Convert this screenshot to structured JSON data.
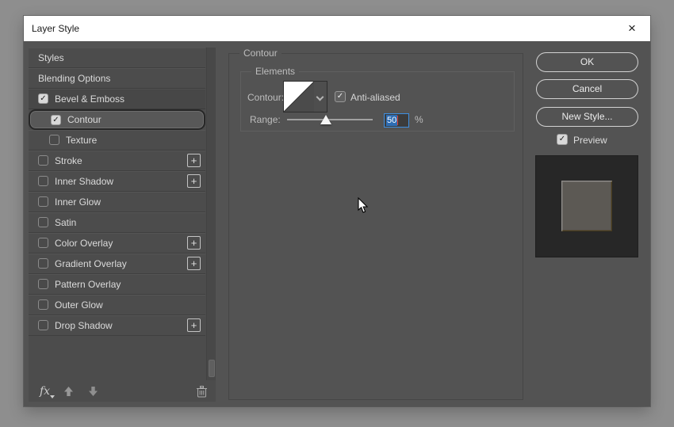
{
  "window": {
    "title": "Layer Style"
  },
  "icons": {
    "close": "×",
    "check": "✓",
    "plus": "+"
  },
  "sidebar": {
    "items": [
      {
        "label": "Styles",
        "checkbox": null,
        "sub": false,
        "selected": false,
        "plus": false,
        "emph": false
      },
      {
        "label": "Blending Options",
        "checkbox": null,
        "sub": false,
        "selected": false,
        "plus": false,
        "emph": false
      },
      {
        "label": "Bevel & Emboss",
        "checkbox": "checked",
        "sub": false,
        "selected": false,
        "plus": false,
        "emph": true
      },
      {
        "label": "Contour",
        "checkbox": "checked",
        "sub": true,
        "selected": true,
        "plus": false,
        "emph": false
      },
      {
        "label": "Texture",
        "checkbox": "unchecked",
        "sub": true,
        "selected": false,
        "plus": false,
        "emph": false
      },
      {
        "label": "Stroke",
        "checkbox": "unchecked",
        "sub": false,
        "selected": false,
        "plus": true,
        "emph": false
      },
      {
        "label": "Inner Shadow",
        "checkbox": "unchecked",
        "sub": false,
        "selected": false,
        "plus": true,
        "emph": false
      },
      {
        "label": "Inner Glow",
        "checkbox": "unchecked",
        "sub": false,
        "selected": false,
        "plus": false,
        "emph": false
      },
      {
        "label": "Satin",
        "checkbox": "unchecked",
        "sub": false,
        "selected": false,
        "plus": false,
        "emph": false
      },
      {
        "label": "Color Overlay",
        "checkbox": "unchecked",
        "sub": false,
        "selected": false,
        "plus": true,
        "emph": false
      },
      {
        "label": "Gradient Overlay",
        "checkbox": "unchecked",
        "sub": false,
        "selected": false,
        "plus": true,
        "emph": false
      },
      {
        "label": "Pattern Overlay",
        "checkbox": "unchecked",
        "sub": false,
        "selected": false,
        "plus": false,
        "emph": false
      },
      {
        "label": "Outer Glow",
        "checkbox": "unchecked",
        "sub": false,
        "selected": false,
        "plus": false,
        "emph": false
      },
      {
        "label": "Drop Shadow",
        "checkbox": "unchecked",
        "sub": false,
        "selected": false,
        "plus": true,
        "emph": false
      }
    ],
    "toolbar": {
      "fx_label": "fx"
    }
  },
  "main": {
    "group_label": "Contour",
    "elements_label": "Elements",
    "contour_label": "Contour:",
    "anti_aliased": {
      "label": "Anti-aliased",
      "checked": true
    },
    "range": {
      "label": "Range:",
      "value": "50",
      "unit": "%",
      "slider_pos_pct": 45
    }
  },
  "actions": {
    "ok": "OK",
    "cancel": "Cancel",
    "new_style": "New Style...",
    "preview": {
      "label": "Preview",
      "checked": true
    }
  },
  "colors": {
    "dialog_bg": "#535353",
    "backdrop": "#8e8e8e",
    "selection_blue": "#2e6db4",
    "focus_border_blue": "#3f8fe0",
    "preview_bg": "#272727"
  }
}
